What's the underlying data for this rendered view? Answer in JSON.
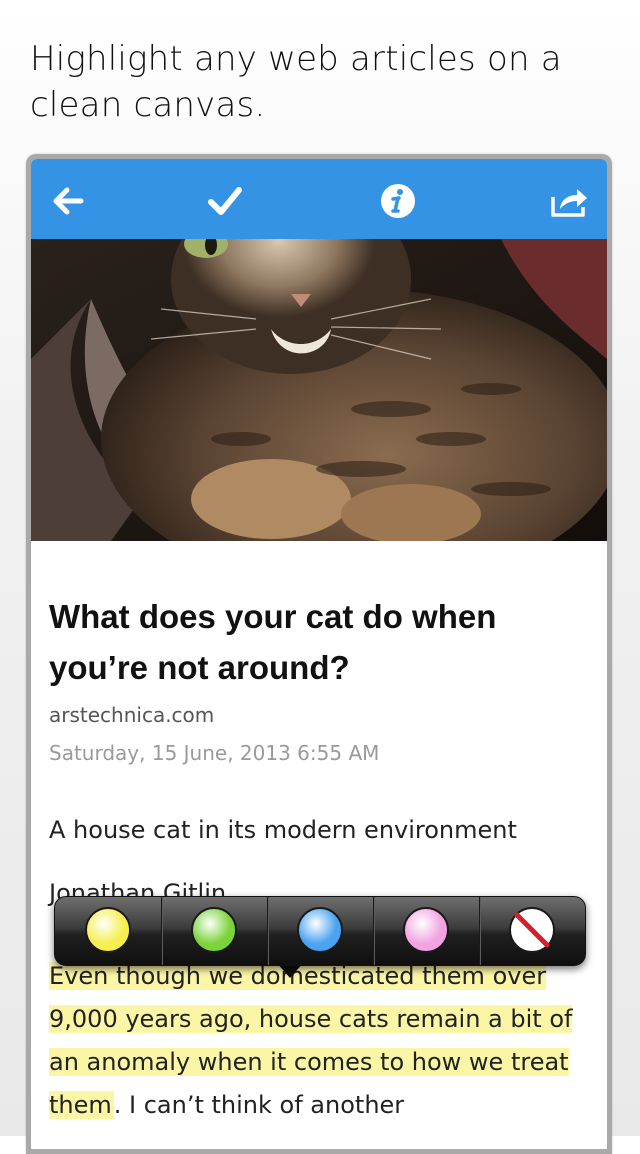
{
  "promo": {
    "headline": "Highlight any web articles on a clean canvas."
  },
  "toolbar": {
    "back_icon": "back-arrow-icon",
    "check_icon": "checkmark-icon",
    "info_icon": "info-icon",
    "share_icon": "share-icon",
    "color": "#3593e6"
  },
  "article": {
    "title": "What does your cat do when you’re not around?",
    "source": "arstechnica.com",
    "date": "Saturday, 15 June, 2013 6:55 AM",
    "caption": "A house cat in its modern environment",
    "byline": "Jonathan Gitlin",
    "body_highlighted": "Even though we domesticated them over 9,000 years ago, house cats remain a bit of an anomaly when it comes to how we treat them",
    "body_rest": ". I can’t think of another"
  },
  "highlight_popup": {
    "colors": [
      {
        "name": "yellow",
        "hex": "#f5ef4f"
      },
      {
        "name": "green",
        "hex": "#7bd43a"
      },
      {
        "name": "blue",
        "hex": "#4ba3f2"
      },
      {
        "name": "pink",
        "hex": "#f3a3e0"
      },
      {
        "name": "remove",
        "hex": "#ffffff"
      }
    ],
    "highlight_color": "#fbf6a6"
  }
}
